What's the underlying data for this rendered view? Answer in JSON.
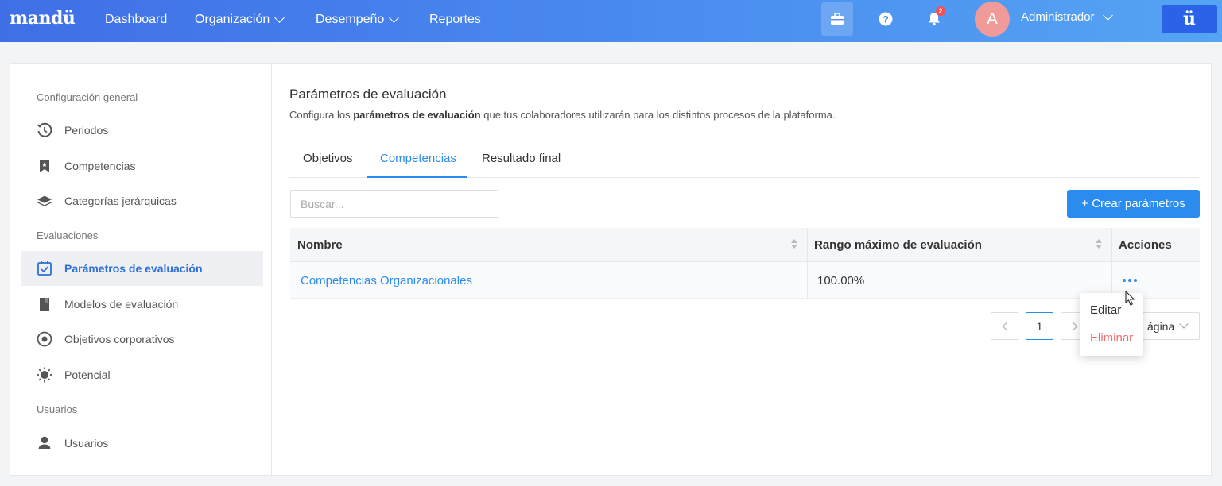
{
  "topbar": {
    "logo": "mandü",
    "nav": [
      {
        "label": "Dashboard"
      },
      {
        "label": "Organización"
      },
      {
        "label": "Desempeño"
      },
      {
        "label": "Reportes"
      }
    ],
    "notifications_count": "2",
    "avatar_initial": "A",
    "user_name": "Administrador",
    "app_button": "ü"
  },
  "sidebar": {
    "sections": [
      "Configuración general",
      "Evaluaciones",
      "Usuarios"
    ],
    "items": [
      {
        "label": "Periodos",
        "icon": "history-icon"
      },
      {
        "label": "Competencias",
        "icon": "bookmark-icon"
      },
      {
        "label": "Categorías jerárquicas",
        "icon": "layers-icon"
      },
      {
        "label": "Parámetros de evaluación",
        "icon": "calendar-check-icon"
      },
      {
        "label": "Modelos de evaluación",
        "icon": "book-icon"
      },
      {
        "label": "Objetivos corporativos",
        "icon": "target-icon"
      },
      {
        "label": "Potencial",
        "icon": "sun-icon"
      },
      {
        "label": "Usuarios",
        "icon": "user-icon"
      }
    ]
  },
  "main": {
    "title": "Parámetros de evaluación",
    "desc_pre": "Configura los ",
    "desc_bold": "parámetros de evaluación",
    "desc_post": " que tus colaboradores utilizarán para los distintos procesos de la plataforma.",
    "tabs": [
      {
        "label": "Objetivos"
      },
      {
        "label": "Competencias"
      },
      {
        "label": "Resultado final"
      }
    ],
    "search_placeholder": "Buscar...",
    "create_button": "+ Crear parámetros",
    "table": {
      "headers": [
        "Nombre",
        "Rango máximo de evaluación",
        "Acciones"
      ],
      "rows": [
        {
          "name": "Competencias Organizacionales",
          "max_range": "100.00%"
        }
      ]
    },
    "pagination": {
      "current_page": "1",
      "page_size_label": "ágina"
    },
    "row_menu": {
      "edit": "Editar",
      "delete": "Eliminar"
    }
  }
}
